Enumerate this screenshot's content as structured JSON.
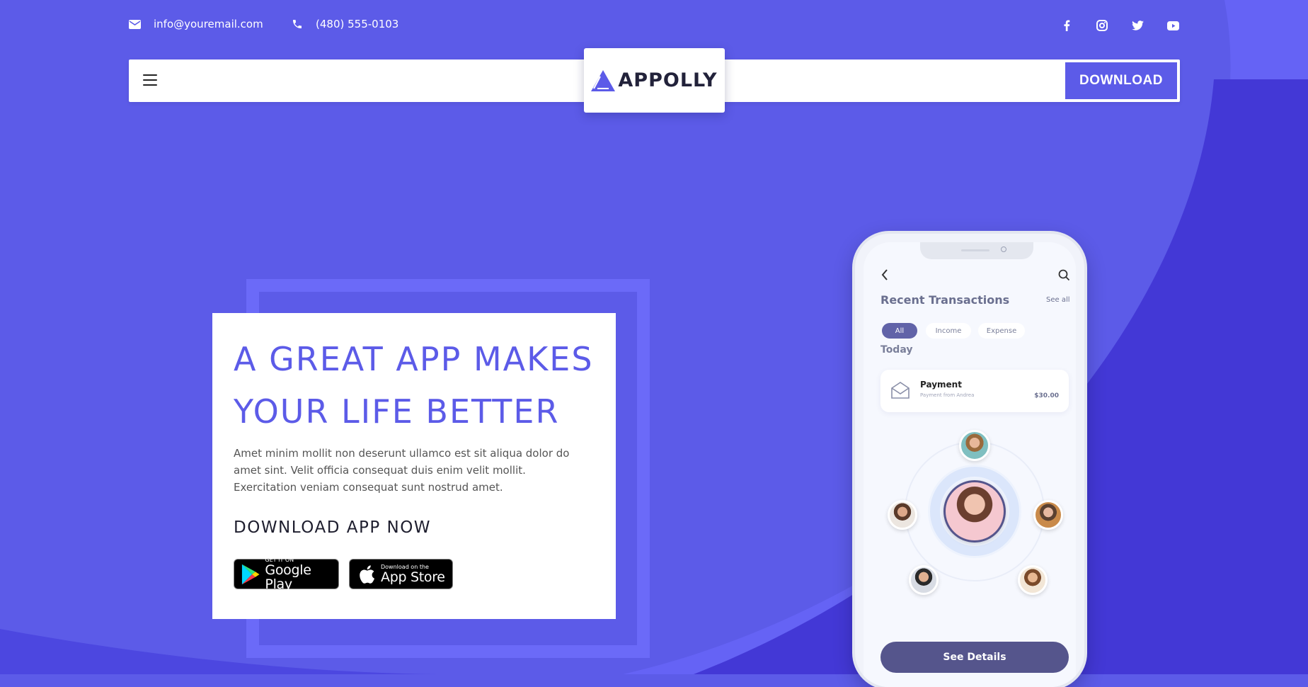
{
  "topbar": {
    "email": "info@youremail.com",
    "phone": "(480) 555-0103",
    "social": [
      "facebook-icon",
      "instagram-icon",
      "twitter-icon",
      "youtube-icon"
    ]
  },
  "navbar": {
    "logo_text": "APPOLLY",
    "download_label": "DOWNLOAD"
  },
  "hero": {
    "headline": "A GREAT APP MAKES YOUR LIFE BETTER",
    "description": "Amet minim mollit non deserunt ullamco est sit aliqua dolor do amet sint. Velit officia consequat duis enim velit mollit. Exercitation veniam consequat sunt nostrud amet.",
    "subheading": "DOWNLOAD APP NOW",
    "google_play": {
      "small": "GET IT ON",
      "big": "Google Play"
    },
    "app_store": {
      "small": "Download on the",
      "big": "App Store"
    }
  },
  "phone": {
    "title": "Recent Transactions",
    "see_all": "See all",
    "filters": [
      "All",
      "Income",
      "Expense"
    ],
    "section": "Today",
    "transaction": {
      "title": "Payment",
      "subtitle": "Payment from Andrea",
      "amount": "$30.00"
    },
    "button": "See Details"
  },
  "colors": {
    "brand": "#5c5be8",
    "background_dark": "#4a44db",
    "frame": "#6b6af8",
    "text_dark": "#1e1e2e"
  }
}
